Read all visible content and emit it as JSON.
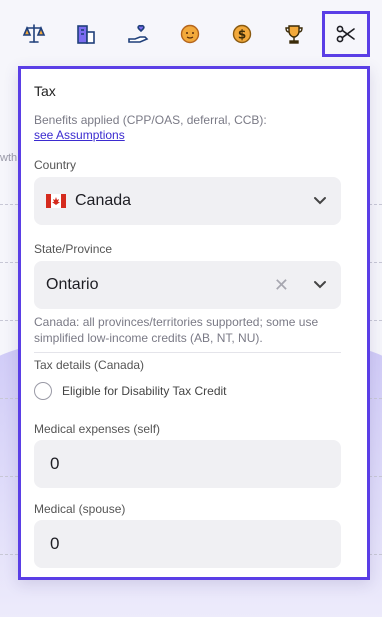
{
  "background": {
    "partial_label": "wth"
  },
  "toolbar": {
    "icons": [
      {
        "name": "balance-scale-icon"
      },
      {
        "name": "building-icon"
      },
      {
        "name": "hand-holding-heart-icon"
      },
      {
        "name": "baby-face-icon"
      },
      {
        "name": "dollar-coin-icon"
      },
      {
        "name": "trophy-icon"
      },
      {
        "name": "scissors-icon",
        "active": true
      }
    ],
    "accent": "#5a3ee6"
  },
  "panel": {
    "title": "Tax",
    "benefits_hint": "Benefits applied (CPP/OAS, deferral, CCB):",
    "assumptions_link": "see Assumptions",
    "country": {
      "label": "Country",
      "value": "Canada",
      "flag": "canada-flag-icon"
    },
    "province": {
      "label": "State/Province",
      "value": "Ontario"
    },
    "province_note_line1": "Canada: all provinces/territories supported; some use",
    "province_note_line2": "simplified low-income credits (AB, NT, NU).",
    "tax_details_heading": "Tax details (Canada)",
    "disability_checkbox": {
      "label": "Eligible for Disability Tax Credit",
      "checked": false
    },
    "medical_self": {
      "label": "Medical expenses (self)",
      "value": "0"
    },
    "medical_spouse": {
      "label": "Medical (spouse)",
      "value": "0"
    }
  }
}
